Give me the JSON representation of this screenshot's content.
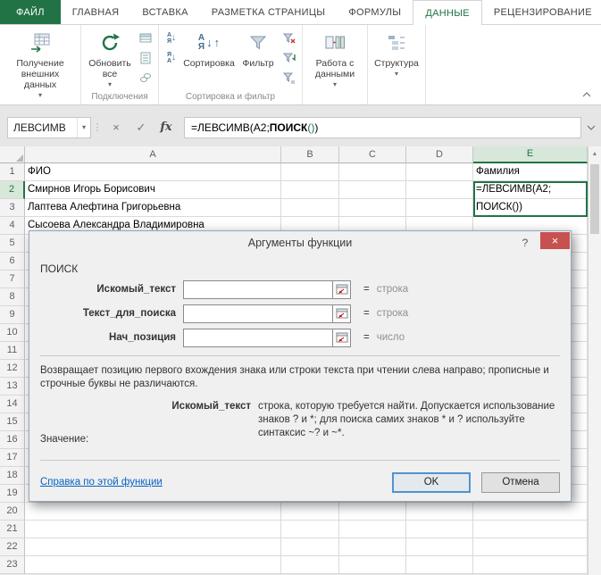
{
  "icons": {
    "dropdown": "▾",
    "close": "×",
    "help": "?",
    "cancel": "×",
    "confirm": "✓",
    "insert_function": "fx",
    "name_box_dropdown": "▾",
    "scroll_up": "▲",
    "dots": "⋮",
    "sort_asc_letters": "А Я",
    "sort_desc_letters": "Я А",
    "sort_arrow_down": "↓",
    "sort_arrow_up": "↑"
  },
  "ribbon": {
    "tabs": [
      {
        "label": "ФАЙЛ",
        "active": false,
        "file": true
      },
      {
        "label": "ГЛАВНАЯ",
        "active": false
      },
      {
        "label": "ВСТАВКА",
        "active": false
      },
      {
        "label": "РАЗМЕТКА СТРАНИЦЫ",
        "active": false
      },
      {
        "label": "ФОРМУЛЫ",
        "active": false
      },
      {
        "label": "ДАННЫЕ",
        "active": true
      },
      {
        "label": "РЕЦЕНЗИРОВАНИЕ",
        "active": false
      }
    ],
    "buttons": {
      "get_external": "Получение внешних данных",
      "refresh_all": "Обновить все",
      "sort": "Сортировка",
      "filter": "Фильтр",
      "data_tools": "Работа с данными",
      "outline": "Структура"
    },
    "group_labels": {
      "connections": "Подключения",
      "sort_filter": "Сортировка и фильтр"
    }
  },
  "formula_bar": {
    "name_box": "ЛЕВСИМВ",
    "formula": {
      "prefix": "=ЛЕВСИМВ(A2;",
      "function": "ПОИСК",
      "parens": "()",
      "close": ")"
    }
  },
  "grid": {
    "columns": [
      "A",
      "B",
      "C",
      "D",
      "E"
    ],
    "row_count": 23,
    "selection": {
      "row": 2,
      "col": "E",
      "active_cell": "E2"
    },
    "cells": {
      "A1": "ФИО",
      "E1": "Фамилия",
      "A2": "Смирнов Игорь Борисович",
      "E2": "=ЛЕВСИМВ(A2;",
      "A3": "Лаптева Алефтина Григорьевна",
      "E3": "ПОИСК())",
      "A4": "Сысоева Александра Владимировна"
    }
  },
  "dialog": {
    "title": "Аргументы функции",
    "function_name": "ПОИСК",
    "equals": "=",
    "fields": [
      {
        "label": "Искомый_текст",
        "value": "",
        "type": "строка"
      },
      {
        "label": "Текст_для_поиска",
        "value": "",
        "type": "строка"
      },
      {
        "label": "Нач_позиция",
        "value": "",
        "type": "число"
      }
    ],
    "description": "Возвращает позицию первого вхождения знака или строки текста при чтении слева направо; прописные и строчные буквы не различаются.",
    "param_help_label": "Искомый_текст",
    "param_help_text": "строка, которую требуется найти. Допускается использование знаков ? и *; для поиска самих знаков * и ? используйте синтаксис ~? и ~*.",
    "value_label": "Значение:",
    "help_link": "Справка по этой функции",
    "ok_label": "OK",
    "cancel_label": "Отмена"
  },
  "colors": {
    "excel_green": "#217346",
    "close_red": "#c75050",
    "link_blue": "#0563c1"
  }
}
